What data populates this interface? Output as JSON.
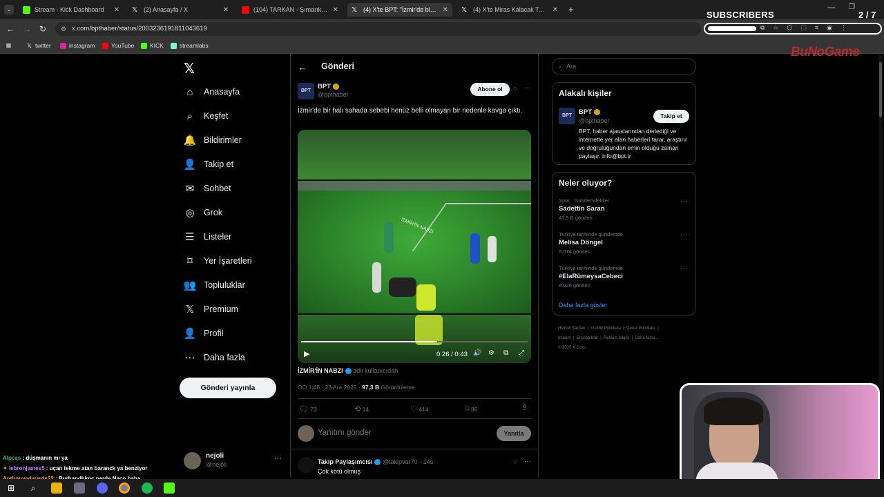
{
  "browser": {
    "tabs": [
      {
        "title": "Stream - Kick Dashboard",
        "active": false,
        "color": "#53fc18"
      },
      {
        "title": "(2) Anasayfa / X",
        "active": false,
        "color": "#ffffff"
      },
      {
        "title": "(104) TARKAN - Şımarık (Of",
        "active": false,
        "color": "#ff0000"
      },
      {
        "title": "(4) X'te BPT: \"İzmir'de bir halı sa",
        "active": true,
        "color": "#ffffff"
      },
      {
        "title": "(4) X'te Miras Kalacak Tweetler",
        "active": false,
        "color": "#ffffff"
      }
    ],
    "url": "x.com/bpthaber/status/2003236191811043619",
    "bookmarks": [
      "twitter",
      "instagram",
      "YouTube",
      "KICK",
      "streamlabs"
    ]
  },
  "overlay": {
    "subscribers_label": "SUBSCRIBERS",
    "subscribers_count": "2 / 7",
    "subscribers_progress": 0.28,
    "brand": "BuNoGame"
  },
  "nav": {
    "items": [
      {
        "label": "Anasayfa",
        "icon": "home-icon"
      },
      {
        "label": "Keşfet",
        "icon": "search-icon"
      },
      {
        "label": "Bildirimler",
        "icon": "bell-icon"
      },
      {
        "label": "Takip et",
        "icon": "follow-icon"
      },
      {
        "label": "Sohbet",
        "icon": "mail-icon"
      },
      {
        "label": "Grok",
        "icon": "grok-icon"
      },
      {
        "label": "Listeler",
        "icon": "list-icon"
      },
      {
        "label": "Yer İşaretleri",
        "icon": "bookmark-icon"
      },
      {
        "label": "Topluluklar",
        "icon": "communities-icon"
      },
      {
        "label": "Premium",
        "icon": "x-icon"
      },
      {
        "label": "Profil",
        "icon": "profile-icon"
      },
      {
        "label": "Daha fazla",
        "icon": "more-icon"
      }
    ],
    "post_button": "Gönderi yayınla",
    "account": {
      "name": "nejoli",
      "handle": "@nejoli"
    }
  },
  "post": {
    "header_title": "Gönderi",
    "author_name": "BPT",
    "author_handle": "@bpthaber",
    "avatar_text": "BPT",
    "subscribe_label": "Abone ol",
    "text": "İzmir'de bir halı sahada sebebi henüz belli olmayan bir nedenle kavga çıktı.",
    "video_time": "0:26 / 0:43",
    "video_progress": 0.6,
    "video_watermark": "İZMİR'İN NABZI",
    "source_user": "İZMİR'İN NABZI",
    "source_suffix": "adlı kullanıcıdan",
    "time_date": "ÖÖ 1:48 · 23 Ara 2025 · ",
    "views": "97,3 B",
    "views_label": " Görüntüleme",
    "stats": {
      "replies": "73",
      "reposts": "14",
      "likes": "414",
      "bookmarks": "86"
    },
    "reply_placeholder": "Yanıtını gönder",
    "reply_button": "Yanıtla",
    "reply": {
      "name": "Takip Paylaşımcısı",
      "handle": "@takipvar70 · 14s",
      "text": "Çok kötü olmuş"
    }
  },
  "right": {
    "search_placeholder": "Ara",
    "related_title": "Alakalı kişiler",
    "related": {
      "name": "BPT",
      "handle": "@bpthaber",
      "follow_label": "Takip et",
      "bio": "BPT, haber ajanslarından derlediği ve internette yer alan haberleri tarar, araştırır ve doğruluğundan emin olduğu zaman paylaşır. info@bpt.tr"
    },
    "trends_title": "Neler oluyor?",
    "trends": [
      {
        "context": "Spor · Gündemdekiler",
        "name": "Sadettin Saran",
        "count": "43,5 B gönderi"
      },
      {
        "context": "Türkiye tarihinde gündemde",
        "name": "Melisa Döngel",
        "count": "6.074 gönderi"
      },
      {
        "context": "Türkiye tarihinde gündemde",
        "name": "#ElaRümeysaCebeci",
        "count": "8.025 gönderi"
      }
    ],
    "show_more": "Daha fazla göster",
    "footer": [
      "Hizmet Şartları",
      "Gizlilik Politikası",
      "Çerez Politikası",
      "Imprint",
      "Erişilebilirlik",
      "Reklam bilgisi",
      "Daha fazla ...",
      "© 2025 X Corp."
    ]
  },
  "chat": [
    {
      "user": "Alpcas",
      "msg": " : düşmanın mı ya",
      "color": "#3cb371"
    },
    {
      "user": "lebronjames5",
      "msg": " : uçan tekme atan baranck ya benziyor",
      "color": "#c77dff"
    },
    {
      "user": "Anthonyedwards22",
      "msg": " : Burhandhkpc nerde Neco baba",
      "color": "#f4a340"
    }
  ]
}
